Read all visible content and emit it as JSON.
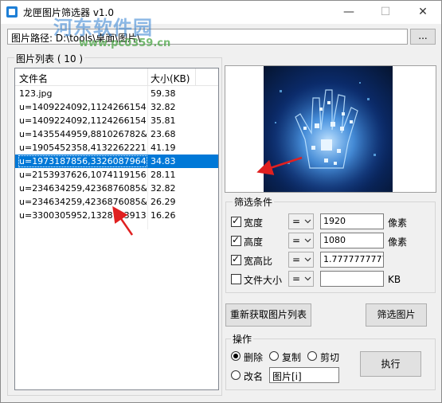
{
  "window": {
    "title": "龙匣图片筛选器 v1.0",
    "controls": {
      "minimize": "—",
      "maximize": "☐",
      "close": "✕"
    }
  },
  "watermark": {
    "text": "河东软件园",
    "url": "www.pc0359.cn"
  },
  "path": {
    "label": "图片路径:",
    "value": "D:\\tools\\桌面\\图片\\",
    "browse_label": "..."
  },
  "list": {
    "group_title": "图片列表 ( 10 )",
    "columns": {
      "name": "文件名",
      "size": "大小(KB)"
    },
    "rows": [
      {
        "name": "123.jpg",
        "size": "59.38"
      },
      {
        "name": "u=1409224092,1124266154...",
        "size": "32.82"
      },
      {
        "name": "u=1409224092,1124266154...",
        "size": "35.81"
      },
      {
        "name": "u=1435544959,881026782&...",
        "size": "23.68"
      },
      {
        "name": "u=1905452358,4132262221...",
        "size": "41.19"
      },
      {
        "name": "u=1973187856,3326087964...",
        "size": "34.83"
      },
      {
        "name": "u=2153937626,1074119156...",
        "size": "28.11"
      },
      {
        "name": "u=234634259,4236876085&...",
        "size": "32.82"
      },
      {
        "name": "u=234634259,4236876085&...",
        "size": "26.29"
      },
      {
        "name": "u=3300305952,1328703913...",
        "size": "16.26"
      }
    ],
    "selected_index": 5
  },
  "filter": {
    "group_title": "筛选条件",
    "width": {
      "label": "宽度",
      "checked": true,
      "op": "=",
      "value": "1920",
      "unit": "像素"
    },
    "height": {
      "label": "高度",
      "checked": true,
      "op": "=",
      "value": "1080",
      "unit": "像素"
    },
    "ratio": {
      "label": "宽高比",
      "checked": true,
      "op": "=",
      "value": "1.7777777777"
    },
    "filesize": {
      "label": "文件大小",
      "checked": false,
      "op": "=",
      "value": "",
      "unit": "KB"
    }
  },
  "buttons": {
    "reload": "重新获取图片列表",
    "filter": "筛选图片",
    "execute": "执行"
  },
  "operations": {
    "group_title": "操作",
    "delete": {
      "label": "删除",
      "selected": true
    },
    "copy": {
      "label": "复制",
      "selected": false
    },
    "cut": {
      "label": "剪切",
      "selected": false
    },
    "rename": {
      "label": "改名",
      "selected": false,
      "pattern": "图片[i]"
    }
  },
  "colors": {
    "selection": "#0078d7",
    "annotation_arrow": "#e02020"
  },
  "icons": [
    "app-icon",
    "combo-arrow-icon",
    "hand-image"
  ]
}
